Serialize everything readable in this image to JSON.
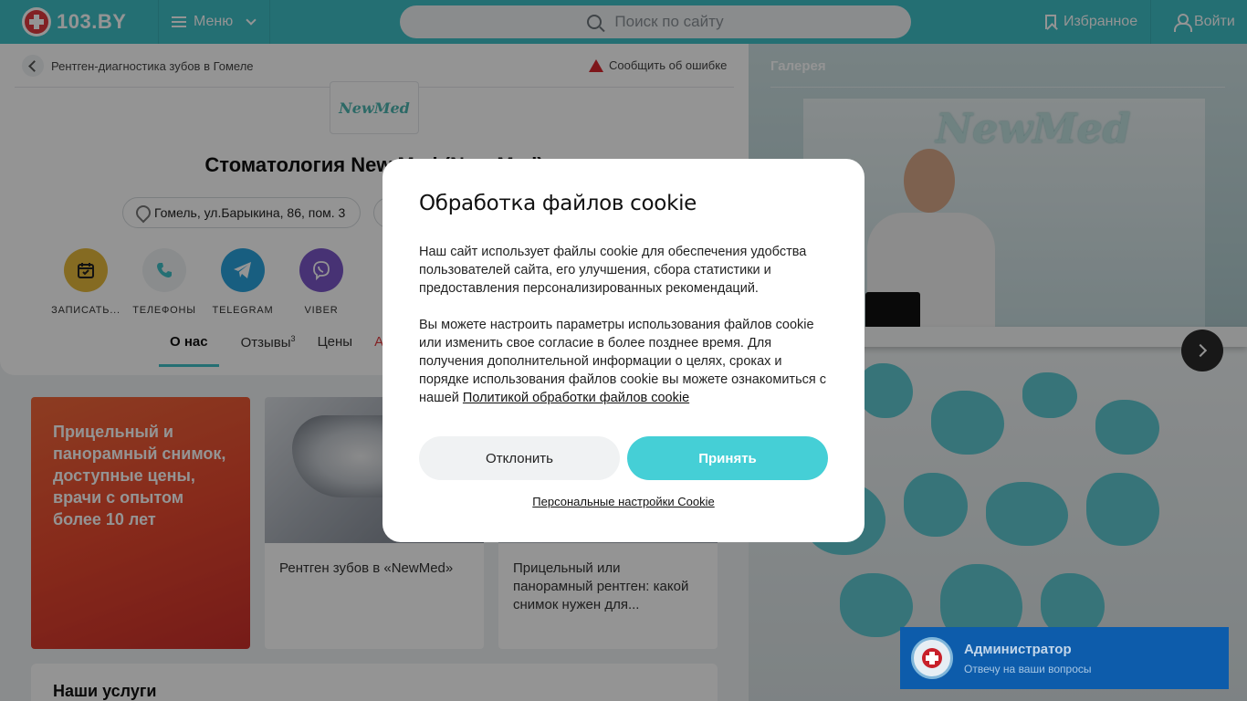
{
  "header": {
    "logo_text": "103.BY",
    "menu_label": "Меню",
    "search_placeholder": "Поиск по сайту",
    "favorites_label": "Избранное",
    "login_label": "Войти"
  },
  "breadcrumb": {
    "label": "Рентген-диагностика зубов в Гомеле"
  },
  "report_error": "Сообщить об ошибке",
  "clinic": {
    "logo_text": "NewMed",
    "title": "Стоматология New Med (New Med)",
    "address": "Гомель, ул.Барыкина, 86, пом. 3"
  },
  "actions": [
    {
      "label": "ЗАПИСАТЬ...",
      "color": "#e6b93b"
    },
    {
      "label": "ТЕЛЕФОНЫ",
      "color": "#eef1f3"
    },
    {
      "label": "TELEGRAM",
      "color": "#2aa3dc"
    },
    {
      "label": "VIBER",
      "color": "#7b57c8"
    }
  ],
  "tabs": [
    {
      "label": "О нас"
    },
    {
      "label": "Отзывы",
      "count": "3"
    },
    {
      "label": "Цены"
    },
    {
      "label": "Ак"
    }
  ],
  "promo_text": "Прицельный и панорамный снимок, доступные цены, врачи с опытом более 10 лет",
  "cards": [
    {
      "title": "Рентген зубов в «NewMed»"
    },
    {
      "title": "Прицельный или панорамный рентген: какой снимок нужен для..."
    }
  ],
  "services_title": "Наши услуги",
  "gallery": {
    "title": "Галерея",
    "sign_text": "NewMed"
  },
  "cookie_modal": {
    "title": "Обработка файлов cookie",
    "paragraph1": "Наш сайт использует файлы cookie для обеспечения удобства пользователей сайта, его улучшения, сбора статистики и предоставления персонализированных рекомендаций.",
    "paragraph2_prefix": "Вы можете настроить параметры использования файлов cookie или изменить свое согласие в более позднее время. Для получения дополнительной информации о целях, сроках и порядке использования файлов cookie вы можете ознакомиться с нашей ",
    "policy_link": "Политикой обработки файлов cookie",
    "decline_label": "Отклонить",
    "accept_label": "Принять",
    "settings_link": "Персональные настройки Cookie"
  },
  "chat": {
    "name": "Администратор",
    "subtitle": "Отвечу на ваши вопросы"
  },
  "colors": {
    "accent": "#3fbfc7",
    "accept_button": "#45cfd6",
    "chat": "#0d5cab",
    "promo": "#e8492f"
  }
}
